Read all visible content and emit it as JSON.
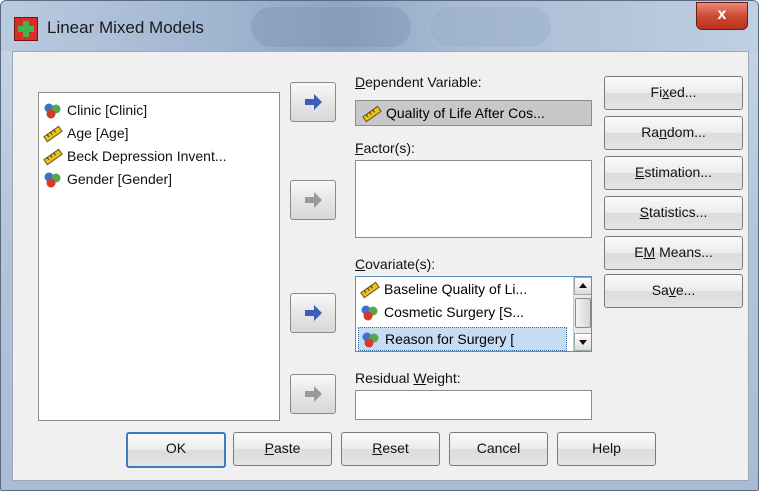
{
  "window": {
    "title": "Linear Mixed Models",
    "close_glyph": "x"
  },
  "source_variables": [
    {
      "label": "Clinic [Clinic]",
      "icon": "nominal-icon"
    },
    {
      "label": "Age [Age]",
      "icon": "scale-icon"
    },
    {
      "label": "Beck Depression Invent...",
      "icon": "scale-icon"
    },
    {
      "label": "Gender [Gender]",
      "icon": "nominal-icon"
    }
  ],
  "dependent": {
    "label_pre": "",
    "label_u": "D",
    "label_post": "ependent Variable:",
    "value": "Quality of Life After Cos..."
  },
  "factors": {
    "label_u": "F",
    "label_post": "actor(s):"
  },
  "covariates": {
    "label_u": "C",
    "label_post": "ovariate(s):",
    "items": [
      {
        "label": "Baseline Quality of Li...",
        "icon": "scale-icon"
      },
      {
        "label": "Cosmetic Surgery [S...",
        "icon": "nominal-icon"
      },
      {
        "label": "Reason for Surgery [",
        "icon": "nominal-icon"
      }
    ]
  },
  "residual_weight": {
    "label_pre": "Residual ",
    "label_u": "W",
    "label_post": "eight:"
  },
  "side_buttons": [
    {
      "pre": "Fi",
      "u": "x",
      "post": "ed..."
    },
    {
      "pre": "Ra",
      "u": "n",
      "post": "dom..."
    },
    {
      "pre": "",
      "u": "E",
      "post": "stimation..."
    },
    {
      "pre": "",
      "u": "S",
      "post": "tatistics..."
    },
    {
      "pre": "E",
      "u": "M",
      "post": " Means..."
    },
    {
      "pre": "Sa",
      "u": "v",
      "post": "e..."
    }
  ],
  "bottom_buttons": [
    {
      "pre": "OK",
      "u": "",
      "post": ""
    },
    {
      "pre": "",
      "u": "P",
      "post": "aste"
    },
    {
      "pre": "",
      "u": "R",
      "post": "eset"
    },
    {
      "pre": "Cancel",
      "u": "",
      "post": ""
    },
    {
      "pre": "Help",
      "u": "",
      "post": ""
    }
  ],
  "colors": {
    "arrow_active": "#3b5fb8",
    "arrow_disabled": "#9a9a9a",
    "ruler_icon": "#e8c020",
    "nominal_icon_red": "#d63a2a",
    "nominal_icon_blue": "#3a72c8",
    "nominal_icon_green": "#52a84a"
  }
}
